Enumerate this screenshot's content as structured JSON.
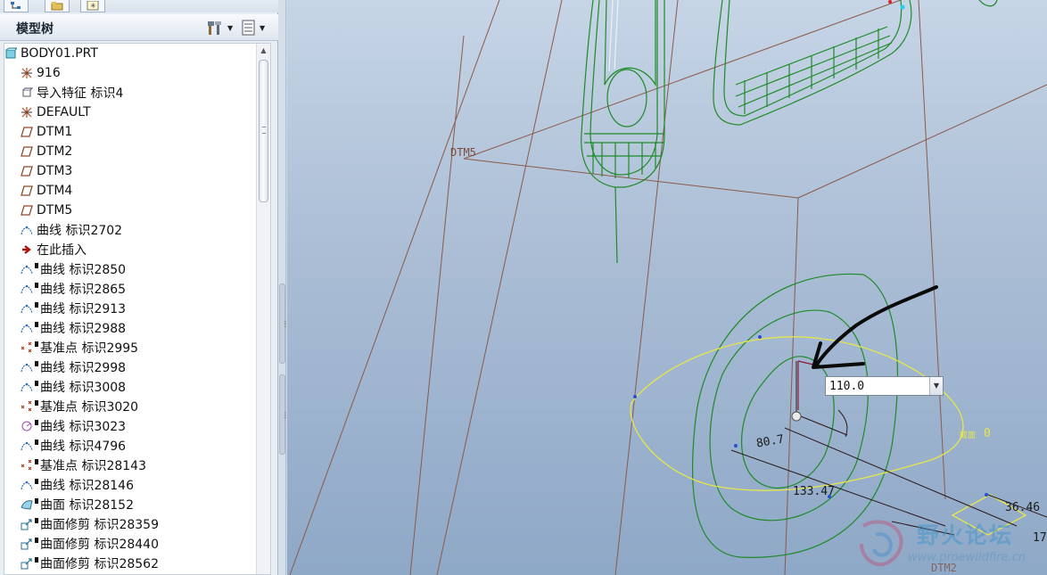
{
  "top_tabs": [
    {
      "icon": "model-tree-tab-icon"
    },
    {
      "icon": "folder-browser-tab-icon"
    },
    {
      "icon": "favorites-tab-icon"
    }
  ],
  "tree_panel": {
    "title": "模型树",
    "settings_button_icon": "tree-settings-icon",
    "columns_button_icon": "tree-columns-icon"
  },
  "tree": {
    "root": {
      "label": "BODY01.PRT",
      "icon": "part-icon"
    },
    "items": [
      {
        "label": "916",
        "icon": "coordinate-system-icon",
        "flag": false
      },
      {
        "label": "导入特征 标识4",
        "icon": "import-feature-icon",
        "flag": false
      },
      {
        "label": "DEFAULT",
        "icon": "coordinate-system-icon",
        "flag": false
      },
      {
        "label": "DTM1",
        "icon": "datum-plane-icon",
        "flag": false
      },
      {
        "label": "DTM2",
        "icon": "datum-plane-icon",
        "flag": false
      },
      {
        "label": "DTM3",
        "icon": "datum-plane-icon",
        "flag": false
      },
      {
        "label": "DTM4",
        "icon": "datum-plane-icon",
        "flag": false
      },
      {
        "label": "DTM5",
        "icon": "datum-plane-icon",
        "flag": false
      },
      {
        "label": "曲线 标识2702",
        "icon": "curve-icon",
        "flag": false
      },
      {
        "label": "在此插入",
        "icon": "insert-here-arrow-icon",
        "flag": false
      },
      {
        "label": "曲线 标识2850",
        "icon": "curve-icon",
        "flag": true
      },
      {
        "label": "曲线 标识2865",
        "icon": "curve-icon",
        "flag": true
      },
      {
        "label": "曲线 标识2913",
        "icon": "curve-icon",
        "flag": true
      },
      {
        "label": "曲线 标识2988",
        "icon": "curve-icon",
        "flag": true
      },
      {
        "label": "基准点 标识2995",
        "icon": "datum-point-icon",
        "flag": true
      },
      {
        "label": "曲线 标识2998",
        "icon": "curve-icon",
        "flag": true
      },
      {
        "label": "曲线 标识3008",
        "icon": "curve-icon",
        "flag": true
      },
      {
        "label": "基准点 标识3020",
        "icon": "datum-point-icon",
        "flag": true
      },
      {
        "label": "曲线 标识3023",
        "icon": "sketch-curve-icon",
        "flag": true
      },
      {
        "label": "曲线 标识4796",
        "icon": "curve-icon",
        "flag": true
      },
      {
        "label": "基准点 标识28143",
        "icon": "datum-point-icon",
        "flag": true
      },
      {
        "label": "曲线 标识28146",
        "icon": "curve-icon",
        "flag": true
      },
      {
        "label": "曲面 标识28152",
        "icon": "surface-icon",
        "flag": true
      },
      {
        "label": "曲面修剪 标识28359",
        "icon": "surface-trim-icon",
        "flag": true
      },
      {
        "label": "曲面修剪 标识28440",
        "icon": "surface-trim-icon",
        "flag": true
      },
      {
        "label": "曲面修剪 标识28562",
        "icon": "surface-trim-icon",
        "flag": true
      }
    ]
  },
  "viewport": {
    "datum_labels": {
      "dtm5": "DTM5",
      "dtm2": "DTM2"
    },
    "dimension_input": {
      "value": "110.0"
    },
    "dimensions": {
      "d1": "80.7",
      "d2": "133.47",
      "d3": "36.46",
      "d4": "17"
    },
    "section_label": "截面",
    "section_value": "0",
    "colors": {
      "background_top": "#c6d5e6",
      "background_bottom": "#8ea8c7",
      "model_green": "#1e8a28",
      "sketch_yellow": "#e6e64a",
      "datum_brown": "#8a5a4a"
    }
  },
  "watermark": {
    "title": "野火论坛",
    "url": "www.proewildfire.cn",
    "icon": "wildfire-logo-icon"
  }
}
